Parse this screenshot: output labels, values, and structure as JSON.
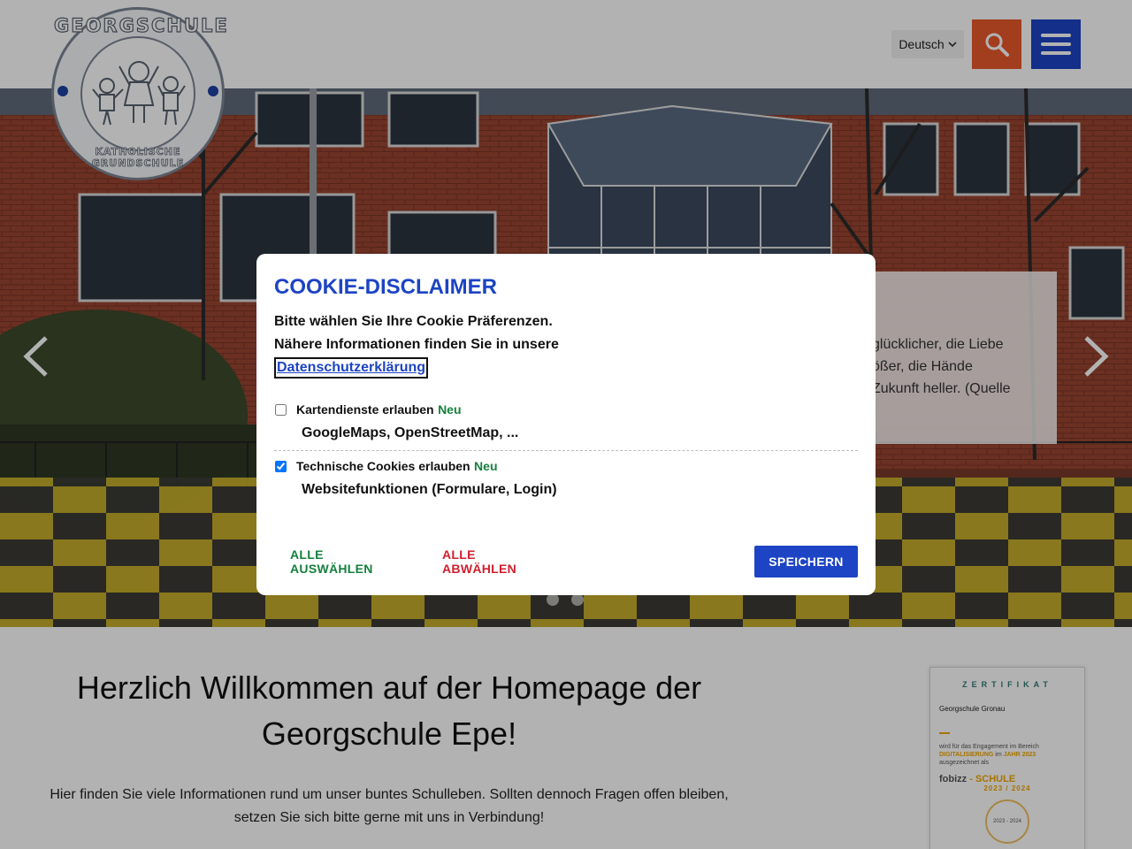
{
  "header": {
    "logo_top_text": "GEORGSCHULE",
    "logo_bottom_text": "KATHOLISCHE GRUNDSCHULE",
    "language": "Deutsch",
    "search_icon": "search-icon",
    "menu_icon": "hamburger-icon"
  },
  "hero": {
    "caption_lines": [
      "glücklicher, die Liebe",
      "ößer, die Hände",
      "Zukunft heller. (Quelle"
    ],
    "prev_icon": "chevron-left-icon",
    "next_icon": "chevron-right-icon",
    "slide_dots": 2
  },
  "cookie": {
    "title": "COOKIE-DISCLAIMER",
    "intro_line1": "Bitte wählen Sie Ihre Cookie Präferenzen.",
    "intro_line2": "Nähere Informationen finden Sie in unsere",
    "privacy_link": "Datenschutzerklärung",
    "options": [
      {
        "label": "Kartendienste erlauben",
        "badge": "Neu",
        "description": "GoogleMaps, OpenStreetMap, ...",
        "checked": false
      },
      {
        "label": "Technische Cookies erlauben",
        "badge": "Neu",
        "description": "Websitefunktionen (Formulare, Login)",
        "checked": true
      }
    ],
    "select_all": "ALLE AUSWÄHLEN",
    "deselect_all": "ALLE ABWÄHLEN",
    "save": "SPEICHERN"
  },
  "main": {
    "welcome_line1": "Herzlich Willkommen auf der Homepage der",
    "welcome_line2": "Georgschule Epe!",
    "intro_line1": "Hier finden Sie viele Informationen rund um unser buntes Schulleben. Sollten dennoch Fragen offen bleiben,",
    "intro_line2": "setzen Sie sich bitte gerne mit uns in Verbindung!"
  },
  "certificate": {
    "title": "ZERTIFIKAT",
    "school": "Georgschule Gronau",
    "body_a": "wird für das Engagement im Bereich",
    "body_hl1": "DIGITALISIERUNG",
    "body_b": "im",
    "body_hl2": "JAHR 2023",
    "body_c": "ausgezeichnet als",
    "brand_a": "fobizz",
    "brand_b": "- SCHULE",
    "years": "2023 / 2024",
    "seal": "2023 - 2024"
  },
  "colors": {
    "primary": "#1d44c4",
    "search": "#e8582b",
    "green": "#15803d",
    "red": "#d11f2f"
  }
}
